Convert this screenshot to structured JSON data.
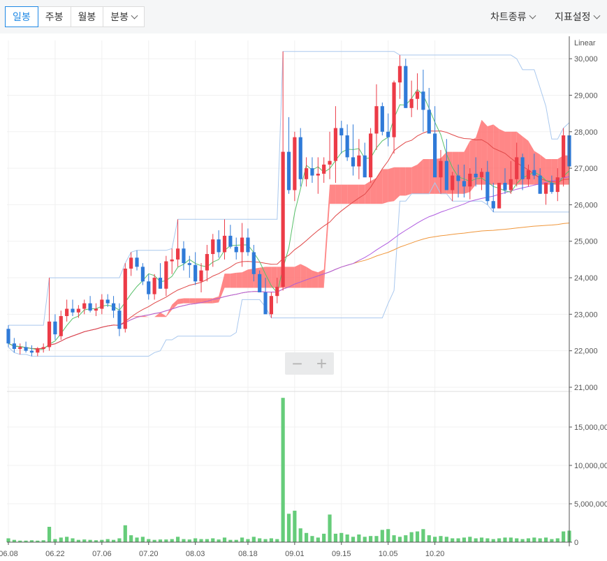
{
  "toolbar": {
    "tabs": [
      {
        "label": "일봉",
        "active": true
      },
      {
        "label": "주봉",
        "active": false
      },
      {
        "label": "월봉",
        "active": false
      },
      {
        "label": "분봉",
        "active": false,
        "dropdown": true
      }
    ],
    "chart_type_menu": "차트종류",
    "indicator_menu": "지표설정"
  },
  "zoom": {
    "out": "−",
    "in": "+"
  },
  "colors": {
    "up": "#ec3b47",
    "down": "#2f7ad8",
    "volume": "#66cc7a",
    "ma5": "#58c06a",
    "ma20": "#e04848",
    "ma60": "#b05ce0",
    "ma120": "#f0963a",
    "band_fill": "#b9d3f3",
    "band_line": "#a9c8ee",
    "cloud_up": "#ff7272",
    "cloud_down": "#8db8ee"
  },
  "chart_data": {
    "type": "candlestick",
    "scale_label": "Linear",
    "price_ylim": [
      21000,
      30500
    ],
    "price_ticks": [
      "21,000",
      "22,000",
      "23,000",
      "24,000",
      "25,000",
      "26,000",
      "27,000",
      "28,000",
      "29,000",
      "30,000"
    ],
    "volume_ylim": [
      0,
      19000000
    ],
    "volume_ticks": [
      "0",
      "5,000,000",
      "10,000,000",
      "15,000,000"
    ],
    "x_labels": [
      "06.08",
      "06.22",
      "07.06",
      "07.20",
      "08.03",
      "08.18",
      "09.01",
      "09.15",
      "10.05",
      "10.20"
    ],
    "x_label_index": [
      0,
      8,
      16,
      24,
      32,
      41,
      49,
      57,
      65,
      73
    ],
    "candles": [
      [
        22600,
        22700,
        22100,
        22200
      ],
      [
        22200,
        22350,
        21950,
        22050
      ],
      [
        22050,
        22200,
        21900,
        22100
      ],
      [
        22100,
        22250,
        21950,
        22000
      ],
      [
        22000,
        22150,
        21850,
        21950
      ],
      [
        21950,
        22100,
        21850,
        22050
      ],
      [
        22050,
        22200,
        21950,
        22100
      ],
      [
        22100,
        24000,
        22000,
        22800
      ],
      [
        22800,
        23000,
        22300,
        22450
      ],
      [
        22400,
        23100,
        22300,
        22950
      ],
      [
        22950,
        23400,
        22800,
        23150
      ],
      [
        23150,
        23400,
        22950,
        23050
      ],
      [
        23050,
        23250,
        22900,
        23150
      ],
      [
        23150,
        23400,
        23000,
        23300
      ],
      [
        23300,
        23500,
        23050,
        23100
      ],
      [
        23100,
        23300,
        22950,
        23150
      ],
      [
        23150,
        23550,
        23000,
        23400
      ],
      [
        23400,
        23550,
        23200,
        23300
      ],
      [
        23300,
        23500,
        22900,
        23100
      ],
      [
        23100,
        23300,
        22400,
        22600
      ],
      [
        22600,
        24400,
        22500,
        24250
      ],
      [
        24250,
        24700,
        24050,
        24550
      ],
      [
        24550,
        24750,
        24200,
        24300
      ],
      [
        24300,
        24400,
        23800,
        23900
      ],
      [
        23900,
        24100,
        23400,
        23550
      ],
      [
        23550,
        24100,
        23400,
        24000
      ],
      [
        24000,
        24400,
        23700,
        23700
      ],
      [
        23700,
        24600,
        23500,
        24450
      ],
      [
        24450,
        24800,
        24100,
        24500
      ],
      [
        24500,
        25600,
        24300,
        24800
      ],
      [
        24800,
        25000,
        24200,
        24400
      ],
      [
        24400,
        24600,
        24000,
        24350
      ],
      [
        24350,
        24700,
        23800,
        23900
      ],
      [
        23900,
        24400,
        23600,
        24200
      ],
      [
        24200,
        24900,
        23900,
        24650
      ],
      [
        24650,
        25200,
        24300,
        25050
      ],
      [
        25050,
        25300,
        24550,
        24700
      ],
      [
        24700,
        25600,
        24500,
        25150
      ],
      [
        25150,
        25450,
        24800,
        24850
      ],
      [
        24850,
        25100,
        24500,
        24700
      ],
      [
        24700,
        25500,
        24300,
        25100
      ],
      [
        25100,
        25350,
        24600,
        24700
      ],
      [
        24700,
        24900,
        23900,
        24100
      ],
      [
        24100,
        24200,
        23600,
        23600
      ],
      [
        23600,
        24000,
        23200,
        23000
      ],
      [
        23000,
        23600,
        22900,
        23500
      ],
      [
        23500,
        24000,
        23300,
        23750
      ],
      [
        23750,
        30200,
        23650,
        27450
      ],
      [
        27450,
        28400,
        26300,
        26400
      ],
      [
        26400,
        28000,
        26100,
        27850
      ],
      [
        27850,
        28100,
        26500,
        26700
      ],
      [
        26700,
        27300,
        26500,
        27000
      ],
      [
        27000,
        27300,
        26600,
        26800
      ],
      [
        26800,
        27300,
        26300,
        26850
      ],
      [
        26850,
        27300,
        26600,
        27100
      ],
      [
        27100,
        28000,
        26700,
        27200
      ],
      [
        27200,
        28700,
        26600,
        28100
      ],
      [
        28100,
        28300,
        27400,
        27900
      ],
      [
        27900,
        28200,
        27200,
        27300
      ],
      [
        27300,
        28200,
        26800,
        27050
      ],
      [
        27050,
        27800,
        26700,
        27350
      ],
      [
        27350,
        27700,
        26900,
        26750
      ],
      [
        26750,
        28100,
        26600,
        27950
      ],
      [
        27950,
        29300,
        27500,
        28700
      ],
      [
        28700,
        28800,
        27900,
        28000
      ],
      [
        28000,
        28500,
        27600,
        27850
      ],
      [
        27850,
        29400,
        27400,
        29350
      ],
      [
        29350,
        30100,
        28900,
        29800
      ],
      [
        29800,
        30000,
        28650,
        28650
      ],
      [
        28650,
        29400,
        28400,
        28900
      ],
      [
        28900,
        29600,
        28600,
        29100
      ],
      [
        29100,
        29700,
        28000,
        28600
      ],
      [
        28600,
        29200,
        28400,
        27950
      ],
      [
        27950,
        28700,
        27000,
        26750
      ],
      [
        26750,
        27500,
        26300,
        27200
      ],
      [
        27200,
        27800,
        26600,
        26400
      ],
      [
        26400,
        26900,
        26100,
        26800
      ],
      [
        26800,
        27100,
        26200,
        26650
      ],
      [
        26650,
        27100,
        26200,
        26500
      ],
      [
        26500,
        27000,
        26150,
        26850
      ],
      [
        26850,
        27300,
        26500,
        26750
      ],
      [
        26750,
        27000,
        26400,
        26900
      ],
      [
        26900,
        27200,
        26000,
        26100
      ],
      [
        26100,
        26600,
        25800,
        25900
      ],
      [
        25900,
        26600,
        25900,
        26600
      ],
      [
        26600,
        27000,
        26300,
        26400
      ],
      [
        26400,
        27200,
        26300,
        26700
      ],
      [
        26700,
        27700,
        26500,
        27300
      ],
      [
        27300,
        27400,
        26400,
        26700
      ],
      [
        26700,
        27100,
        26500,
        26950
      ],
      [
        26950,
        27400,
        26700,
        26800
      ],
      [
        26800,
        27000,
        26300,
        26300
      ],
      [
        26300,
        26600,
        26000,
        26600
      ],
      [
        26600,
        26800,
        26300,
        26350
      ],
      [
        26350,
        27000,
        26100,
        26750
      ],
      [
        26750,
        28100,
        26500,
        27900
      ],
      [
        27900,
        28250,
        27000,
        27050
      ]
    ],
    "volumes": [
      500000,
      300000,
      200000,
      200000,
      250000,
      200000,
      250000,
      2000000,
      400000,
      600000,
      700000,
      500000,
      300000,
      350000,
      300000,
      250000,
      300000,
      400000,
      300000,
      500000,
      2200000,
      900000,
      600000,
      700000,
      400000,
      300000,
      350000,
      350000,
      400000,
      700000,
      400000,
      350000,
      500000,
      400000,
      400000,
      500000,
      350000,
      600000,
      300000,
      300000,
      600000,
      400000,
      700000,
      500000,
      400000,
      500000,
      400000,
      18800000,
      3700000,
      4100000,
      1800000,
      1200000,
      800000,
      600000,
      1100000,
      3600000,
      1100000,
      1200000,
      1000000,
      700000,
      1000000,
      700000,
      800000,
      800000,
      1600000,
      1700000,
      900000,
      700000,
      900000,
      1300000,
      1400000,
      1700000,
      900000,
      700000,
      800000,
      700000,
      500000,
      500000,
      600000,
      700000,
      500000,
      600000,
      500000,
      400000,
      500000,
      600000,
      600000,
      500000,
      400000,
      500000,
      600000,
      500000,
      600000,
      400000,
      500000,
      1400000,
      1500000
    ]
  }
}
